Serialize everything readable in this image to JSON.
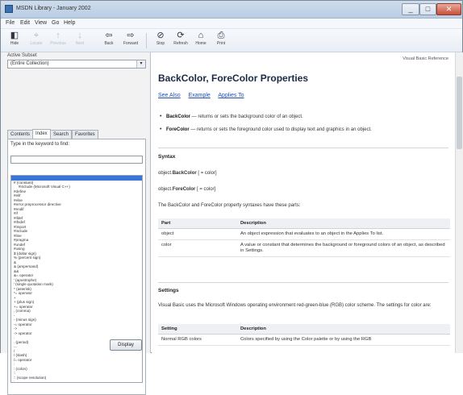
{
  "window": {
    "title": "MSDN Library - January 2002",
    "buttons": {
      "minimize": "_",
      "maximize": "□",
      "close": "✕"
    }
  },
  "menu": [
    "File",
    "Edit",
    "View",
    "Go",
    "Help"
  ],
  "toolbar": [
    {
      "label": "Hide",
      "icon": "hide-icon",
      "glyph": "◧",
      "enabled": true
    },
    {
      "label": "Locate",
      "icon": "locate-icon",
      "glyph": "⌖",
      "enabled": false
    },
    {
      "label": "Previous",
      "icon": "previous-icon",
      "glyph": "↑",
      "enabled": false
    },
    {
      "label": "Next",
      "icon": "next-icon",
      "glyph": "↓",
      "enabled": false
    },
    {
      "label": "Back",
      "icon": "back-arrow-icon",
      "glyph": "⇦",
      "enabled": true
    },
    {
      "label": "Forward",
      "icon": "forward-arrow-icon",
      "glyph": "⇨",
      "enabled": true
    },
    {
      "label": "Stop",
      "icon": "stop-icon",
      "glyph": "⊘",
      "enabled": true
    },
    {
      "label": "Refresh",
      "icon": "refresh-icon",
      "glyph": "⟳",
      "enabled": true
    },
    {
      "label": "Home",
      "icon": "home-icon",
      "glyph": "⌂",
      "enabled": true
    },
    {
      "label": "Print",
      "icon": "print-icon",
      "glyph": "⎙",
      "enabled": true
    }
  ],
  "nav": {
    "subset_label": "Active Subset",
    "subset_value": "(Entire Collection)",
    "tabs": [
      "Contents",
      "Index",
      "Search",
      "Favorites"
    ],
    "active_tab": "Index",
    "keyword_label": "Type in the keyword to find:",
    "keyword_value": "",
    "display_button": "Display",
    "keywords": [
      {
        "text": "",
        "selected": true
      },
      {
        "text": "# (constant)",
        "indent": false
      },
      {
        "text": "#include (Microsoft Visual C++)",
        "indent": true
      },
      {
        "text": "#define",
        "indent": false
      },
      {
        "text": "#elif",
        "indent": false
      },
      {
        "text": "#else",
        "indent": false
      },
      {
        "text": "#error preprocessor directive",
        "indent": false
      },
      {
        "text": "#endif",
        "indent": false
      },
      {
        "text": "#if",
        "indent": false
      },
      {
        "text": "#ifdef",
        "indent": false
      },
      {
        "text": "#ifndef",
        "indent": false
      },
      {
        "text": "#import",
        "indent": false
      },
      {
        "text": "#include",
        "indent": false
      },
      {
        "text": "#line",
        "indent": false
      },
      {
        "text": "#pragma",
        "indent": false
      },
      {
        "text": "#undef",
        "indent": false
      },
      {
        "text": "#using",
        "indent": false
      },
      {
        "text": "$ (dollar sign)",
        "indent": false
      },
      {
        "text": "% (percent sign)",
        "indent": false
      },
      {
        "text": "&",
        "indent": false
      },
      {
        "text": "& (ampersand)",
        "indent": false
      },
      {
        "text": "&&",
        "indent": false
      },
      {
        "text": "&= operator",
        "indent": false
      },
      {
        "text": "' (apostrophe)",
        "indent": false
      },
      {
        "text": "' (single quotation mark)",
        "indent": false
      },
      {
        "text": "* (asterisk)",
        "indent": false
      },
      {
        "text": "*= operator",
        "indent": false
      },
      {
        "text": "+",
        "indent": false
      },
      {
        "text": "+ (plus sign)",
        "indent": false
      },
      {
        "text": "+= operator",
        "indent": false
      },
      {
        "text": ", (comma)",
        "indent": false
      },
      {
        "text": "-",
        "indent": false
      },
      {
        "text": "- (minus sign)",
        "indent": false
      },
      {
        "text": "-= operator",
        "indent": false
      },
      {
        "text": "->",
        "indent": false
      },
      {
        "text": "-> operator",
        "indent": false
      },
      {
        "text": ".",
        "indent": false
      },
      {
        "text": ". (period)",
        "indent": false
      },
      {
        "text": "...",
        "indent": false
      },
      {
        "text": "/",
        "indent": false
      },
      {
        "text": "/ (slash)",
        "indent": false
      },
      {
        "text": "/= operator",
        "indent": false
      },
      {
        "text": ":",
        "indent": false
      },
      {
        "text": ": (colon)",
        "indent": false
      },
      {
        "text": "::",
        "indent": false
      },
      {
        "text": ":: (scope resolution)",
        "indent": false
      },
      {
        "text": ";",
        "indent": false
      }
    ]
  },
  "content": {
    "header_link": "Visual Basic Reference",
    "title": "BackColor, ForeColor Properties",
    "links": [
      "See Also",
      "Example",
      "Applies To"
    ],
    "bullets": [
      {
        "term": "BackColor",
        "text": " — returns or sets the background color of an object."
      },
      {
        "term": "ForeColor",
        "text": " — returns or sets the foreground color used to display text and graphics in an object."
      }
    ],
    "syntax_heading": "Syntax",
    "syntax_lines": [
      {
        "prefix": "object.",
        "term": "BackColor",
        "suffix": " [ = color]"
      },
      {
        "prefix": "object.",
        "term": "ForeColor",
        "suffix": " [ = color]"
      }
    ],
    "parts_intro": "The BackColor and ForeColor property syntaxes have these parts:",
    "parts_table": {
      "headers": [
        "Part",
        "Description"
      ],
      "rows": [
        [
          "object",
          "An object expression that evaluates to an object in the Applies To list."
        ],
        [
          "color",
          "A value or constant that determines the background or foreground colors of an object, as described in Settings."
        ]
      ]
    },
    "settings_heading": "Settings",
    "settings_text": "Visual Basic uses the Microsoft Windows operating environment red-green-blue (RGB) color scheme. The settings for color are:",
    "settings_table": {
      "headers": [
        "Setting",
        "Description"
      ],
      "rows": [
        [
          "Normal RGB colors",
          "Colors specified by using the Color palette or by using the RGB"
        ]
      ]
    }
  }
}
